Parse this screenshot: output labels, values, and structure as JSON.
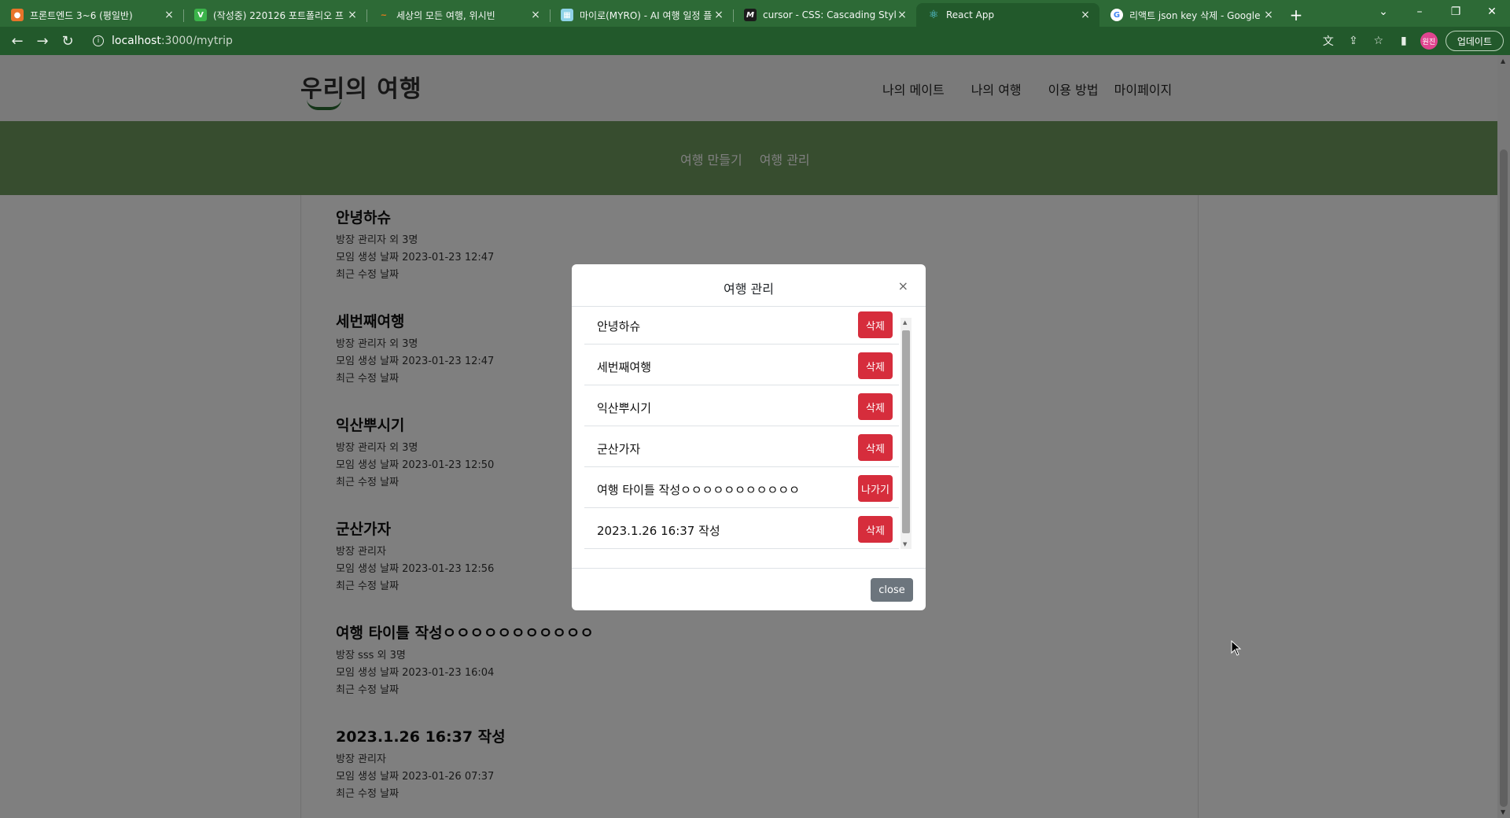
{
  "browser": {
    "tabs": [
      {
        "title": "프론트엔드 3~6 (평일반)",
        "favicon_color": "#e8742a",
        "fav": "●"
      },
      {
        "title": "(작성중) 220126 포트폴리오 프",
        "favicon_color": "#3bb34a",
        "fav": "V"
      },
      {
        "title": "세상의 모든 여행, 위시빈",
        "favicon_color": "#f07b1a",
        "fav": "~"
      },
      {
        "title": "마이로(MYRO) - AI 여행 일정 플",
        "favicon_color": "#8fd3e8",
        "fav": "▦"
      },
      {
        "title": "cursor - CSS: Cascading Style S",
        "favicon_color": "#1b1b1b",
        "fav": "M"
      },
      {
        "title": "React App",
        "favicon_color": "#61dafb",
        "fav": "⚛"
      },
      {
        "title": "리액트 json key 삭제 - Google",
        "favicon_color": "#ffffff",
        "fav": "G"
      }
    ],
    "url_host": "localhost",
    "url_path": ":3000/mytrip",
    "profile_label": "원진",
    "update_label": "업데이트"
  },
  "site": {
    "logo": "우리의 여행",
    "nav": [
      "나의 메이트",
      "나의 여행",
      "이용 방법",
      "마이페이지"
    ],
    "subnav": [
      "여행 만들기",
      "여행 관리"
    ]
  },
  "trips": [
    {
      "title": "안녕하슈",
      "owner": "방장 관리자 외 3명",
      "created": "모임 생성 날짜 2023-01-23 12:47",
      "modified": "최근 수정 날짜"
    },
    {
      "title": "세번째여행",
      "owner": "방장 관리자 외 3명",
      "created": "모임 생성 날짜 2023-01-23 12:47",
      "modified": "최근 수정 날짜"
    },
    {
      "title": "익산뿌시기",
      "owner": "방장 관리자 외 3명",
      "created": "모임 생성 날짜 2023-01-23 12:50",
      "modified": "최근 수정 날짜"
    },
    {
      "title": "군산가자",
      "owner": "방장 관리자",
      "created": "모임 생성 날짜 2023-01-23 12:56",
      "modified": "최근 수정 날짜"
    },
    {
      "title": "여행 타이틀 작성ㅇㅇㅇㅇㅇㅇㅇㅇㅇㅇㅇ",
      "owner": "방장 sss 외 3명",
      "created": "모임 생성 날짜 2023-01-23 16:04",
      "modified": "최근 수정 날짜"
    },
    {
      "title": "2023.1.26 16:37 작성",
      "owner": "방장 관리자",
      "created": "모임 생성 날짜 2023-01-26 07:37",
      "modified": "최근 수정 날짜"
    }
  ],
  "modal": {
    "title": "여행 관리",
    "close_x": "×",
    "items": [
      {
        "name": "안녕하슈",
        "action": "삭제"
      },
      {
        "name": "세번째여행",
        "action": "삭제"
      },
      {
        "name": "익산뿌시기",
        "action": "삭제"
      },
      {
        "name": "군산가자",
        "action": "삭제"
      },
      {
        "name": "여행 타이틀 작성ㅇㅇㅇㅇㅇㅇㅇㅇㅇㅇㅇ",
        "action": "나가기"
      },
      {
        "name": "2023.1.26 16:37 작성",
        "action": "삭제"
      }
    ],
    "close_label": "close"
  },
  "colors": {
    "chrome": "#2d6a36",
    "subnav": "#6f9a5f",
    "danger": "#d62d3c",
    "secondary": "#6c757d"
  }
}
